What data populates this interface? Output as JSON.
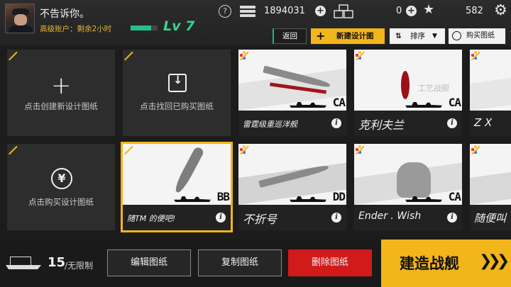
{
  "player": {
    "name": "不告诉你。",
    "account_status": "高级账户：剩余2小时",
    "level": "Lv 7",
    "xp_fraction": 0.75
  },
  "resources": {
    "coins": "1894031",
    "crates": "0",
    "stars": "582"
  },
  "icons": {
    "help": "?",
    "plus": "+",
    "star": "★",
    "gear": "⚙",
    "info": "i"
  },
  "toolbar": {
    "back_label": "返回",
    "new_design_plus": "+",
    "new_design_label": "新建设计图",
    "sort_icon": "⇅",
    "sort_label": "排序",
    "sort_chevron": "▼",
    "buy_label": "购买图纸"
  },
  "action_cards": {
    "create_label": "点击创建新设计图纸",
    "retrieve_label": "点击找回已购买图纸",
    "purchase_label": "点击购买设计图纸",
    "create_symbol": "+",
    "purchase_symbol": "¥"
  },
  "designs": [
    {
      "name": "雷霆级重巡洋舰",
      "class_tag": "CA"
    },
    {
      "name": "克利夫兰",
      "class_tag": "CA",
      "watermark": "工艺战舰"
    },
    {
      "name": "Z X",
      "class_tag": ""
    },
    {
      "name": "随TM 的便吧!",
      "class_tag": "BB"
    },
    {
      "name": "不折号",
      "class_tag": "DD"
    },
    {
      "name": "Ender . Wish",
      "class_tag": "CA"
    },
    {
      "name": "随便叫",
      "class_tag": ""
    }
  ],
  "bottom": {
    "count": "15",
    "count_suffix": "/无限制",
    "edit_label": "编辑图纸",
    "copy_label": "复制图纸",
    "delete_label": "删除图纸",
    "build_label": "建造战舰",
    "build_arrows": "❯❯❯"
  },
  "colors": {
    "accent_yellow": "#f2b51a",
    "level_green": "#36d48e",
    "delete_red": "#d11a1a",
    "account_gold": "#e3b43a"
  }
}
